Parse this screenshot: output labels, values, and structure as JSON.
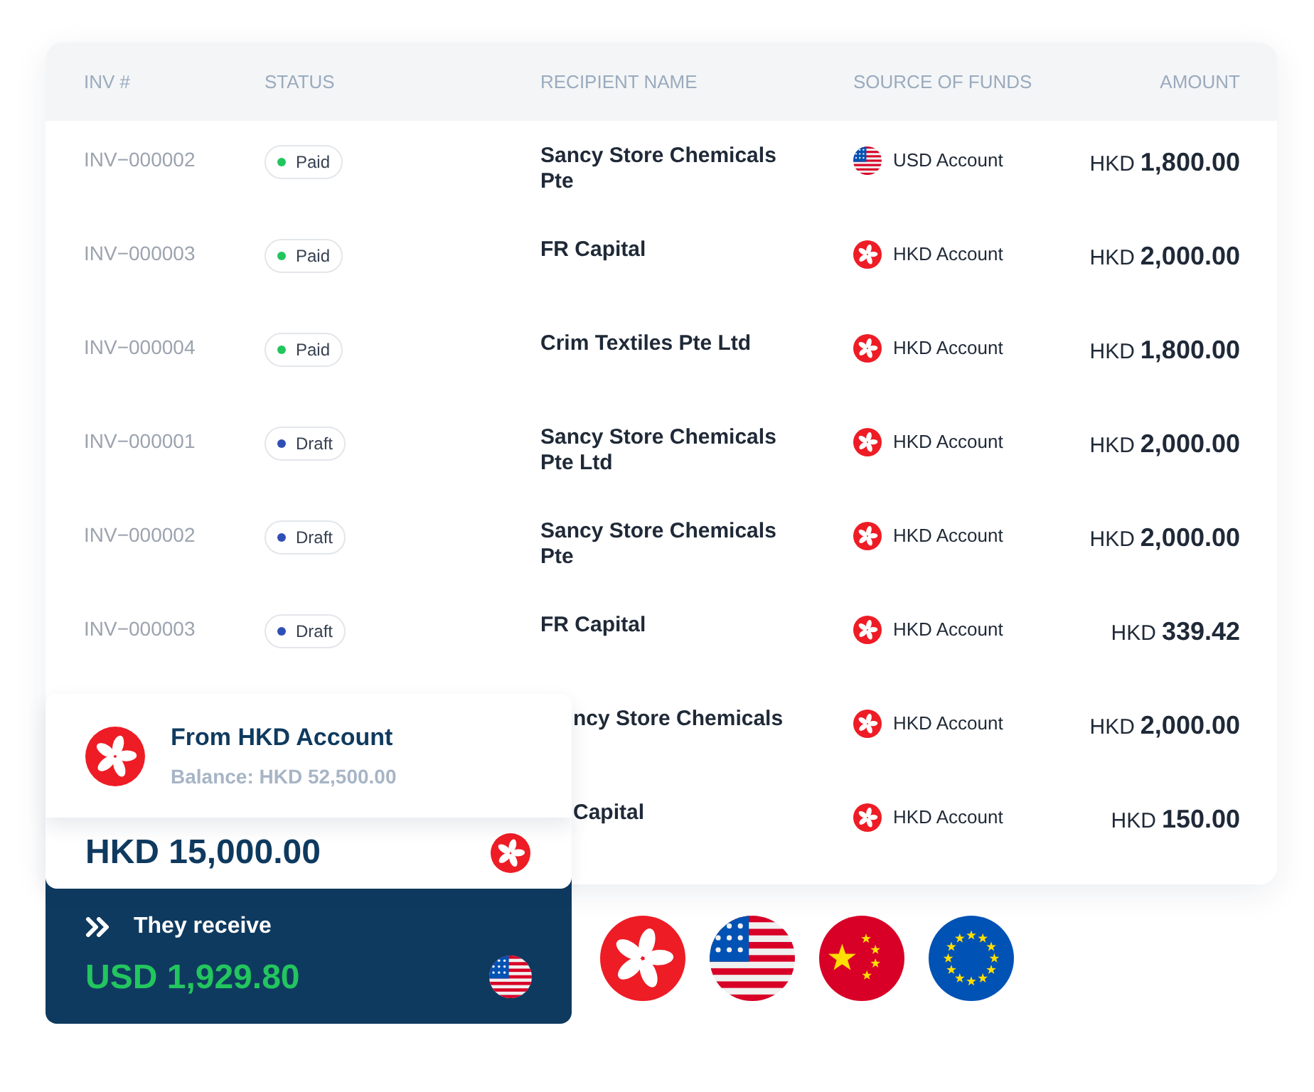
{
  "table": {
    "columns": [
      "INV #",
      "STATUS",
      "RECIPIENT NAME",
      "SOURCE OF FUNDS",
      "AMOUNT"
    ],
    "rows": [
      {
        "inv": "INV−000002",
        "status": {
          "label": "Paid",
          "color": "#22c55e"
        },
        "recipient": "Sancy Store Chemicals Pte",
        "source": {
          "label": "USD Account",
          "kind": "usd"
        },
        "currency": "HKD",
        "amount": "1,800.00"
      },
      {
        "inv": "INV−000003",
        "status": {
          "label": "Paid",
          "color": "#22c55e"
        },
        "recipient": "FR Capital",
        "source": {
          "label": "HKD Account",
          "kind": "hkd"
        },
        "currency": "HKD",
        "amount": "2,000.00"
      },
      {
        "inv": "INV−000004",
        "status": {
          "label": "Paid",
          "color": "#22c55e"
        },
        "recipient": "Crim Textiles Pte Ltd",
        "source": {
          "label": "HKD Account",
          "kind": "hkd"
        },
        "currency": "HKD",
        "amount": "1,800.00"
      },
      {
        "inv": "INV−000001",
        "status": {
          "label": "Draft",
          "color": "#2f4fb5"
        },
        "recipient": "Sancy Store Chemicals Pte Ltd",
        "source": {
          "label": "HKD Account",
          "kind": "hkd"
        },
        "currency": "HKD",
        "amount": "2,000.00"
      },
      {
        "inv": "INV−000002",
        "status": {
          "label": "Draft",
          "color": "#2f4fb5"
        },
        "recipient": "Sancy Store Chemicals Pte",
        "source": {
          "label": "HKD Account",
          "kind": "hkd"
        },
        "currency": "HKD",
        "amount": "2,000.00"
      },
      {
        "inv": "INV−000003",
        "status": {
          "label": "Draft",
          "color": "#2f4fb5"
        },
        "recipient": "FR Capital",
        "source": {
          "label": "HKD Account",
          "kind": "hkd"
        },
        "currency": "HKD",
        "amount": "339.42"
      },
      {
        "recipient": "ncy Store Chemicals",
        "source": {
          "label": "HKD Account",
          "kind": "hkd"
        },
        "currency": "HKD",
        "amount": "2,000.00"
      },
      {
        "recipient": "Capital",
        "source": {
          "label": "HKD Account",
          "kind": "hkd"
        },
        "currency": "HKD",
        "amount": "150.00"
      }
    ]
  },
  "transfer_card": {
    "from": {
      "title": "From HKD Account",
      "balance": "Balance: HKD 52,500.00",
      "kind": "hkd"
    },
    "send": {
      "amount": "HKD 15,000.00",
      "kind": "hkd"
    },
    "receive": {
      "label": "They receive",
      "amount": "USD 1,929.80",
      "kind": "usd"
    }
  },
  "currency_flags": [
    {
      "kind": "hkd"
    },
    {
      "kind": "usd"
    },
    {
      "kind": "cny"
    },
    {
      "kind": "eur"
    }
  ]
}
